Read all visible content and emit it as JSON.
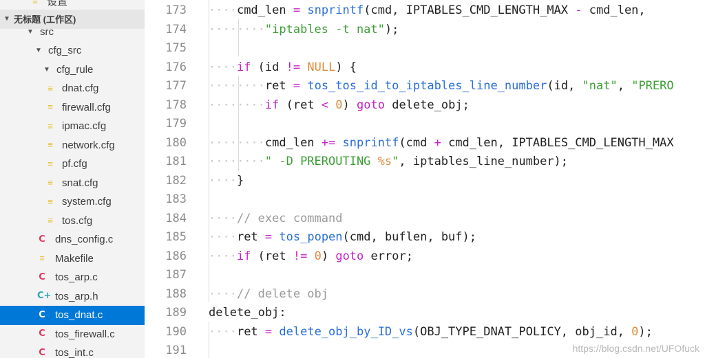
{
  "sidebar": {
    "top_partial": "设置",
    "workspace": "无标题 (工作区)",
    "tree": [
      {
        "label": "src",
        "kind": "folder"
      },
      {
        "label": "cfg_src",
        "kind": "folder"
      },
      {
        "label": "cfg_rule",
        "kind": "folder"
      },
      {
        "label": "dnat.cfg",
        "kind": "cfg"
      },
      {
        "label": "firewall.cfg",
        "kind": "cfg"
      },
      {
        "label": "ipmac.cfg",
        "kind": "cfg"
      },
      {
        "label": "network.cfg",
        "kind": "cfg"
      },
      {
        "label": "pf.cfg",
        "kind": "cfg"
      },
      {
        "label": "snat.cfg",
        "kind": "cfg"
      },
      {
        "label": "system.cfg",
        "kind": "cfg"
      },
      {
        "label": "tos.cfg",
        "kind": "cfg"
      },
      {
        "label": "dns_config.c",
        "kind": "c"
      },
      {
        "label": "Makefile",
        "kind": "make"
      },
      {
        "label": "tos_arp.c",
        "kind": "c"
      },
      {
        "label": "tos_arp.h",
        "kind": "h"
      },
      {
        "label": "tos_dnat.c",
        "kind": "c",
        "selected": true
      },
      {
        "label": "tos_firewall.c",
        "kind": "c"
      },
      {
        "label": "tos_int.c",
        "kind": "c"
      }
    ]
  },
  "editor": {
    "line_numbers": [
      "173",
      "174",
      "175",
      "176",
      "177",
      "178",
      "179",
      "180",
      "181",
      "182",
      "183",
      "184",
      "185",
      "186",
      "187",
      "188",
      "189",
      "190",
      "191"
    ]
  },
  "watermark": "https://blog.csdn.net/UFOfuck",
  "colors": {
    "selection": "#0078d7",
    "keyword": "#c61fc6",
    "function": "#2b6fd6",
    "string": "#3e9e36",
    "number": "#e08d3c",
    "comment": "#9a9a9a"
  }
}
